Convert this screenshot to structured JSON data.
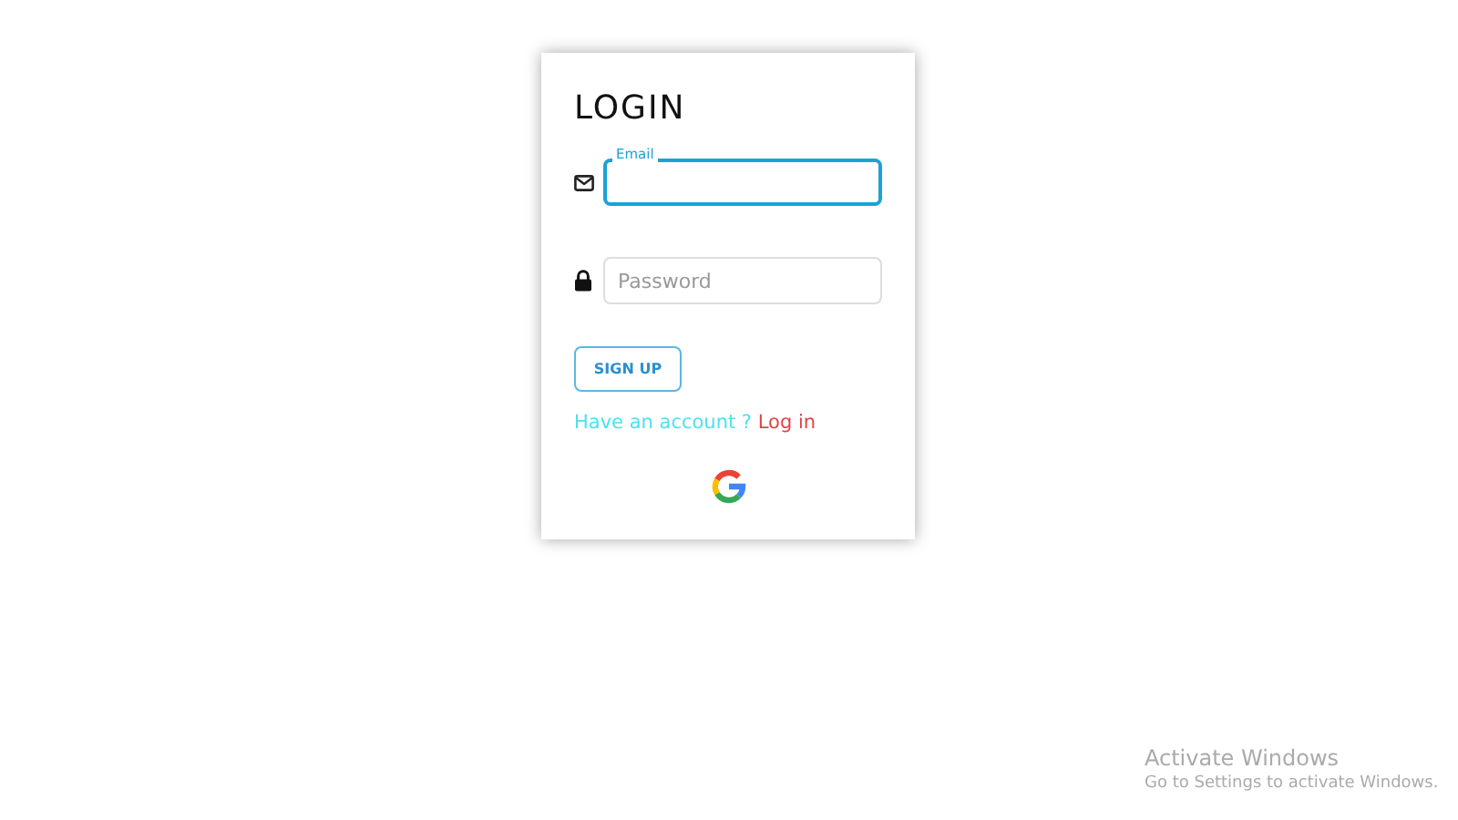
{
  "card": {
    "title": "LOGIN",
    "fields": [
      {
        "kind": "email",
        "label": "Email",
        "focused": true
      },
      {
        "kind": "password",
        "placeholder": "Password",
        "focused": false
      }
    ],
    "button": "SIGN UP",
    "prompt": {
      "text": "Have an account ?",
      "link": "Log in"
    }
  },
  "os_watermark": {
    "title": "Activate Windows",
    "text": "Go to Settings to activate Windows."
  }
}
